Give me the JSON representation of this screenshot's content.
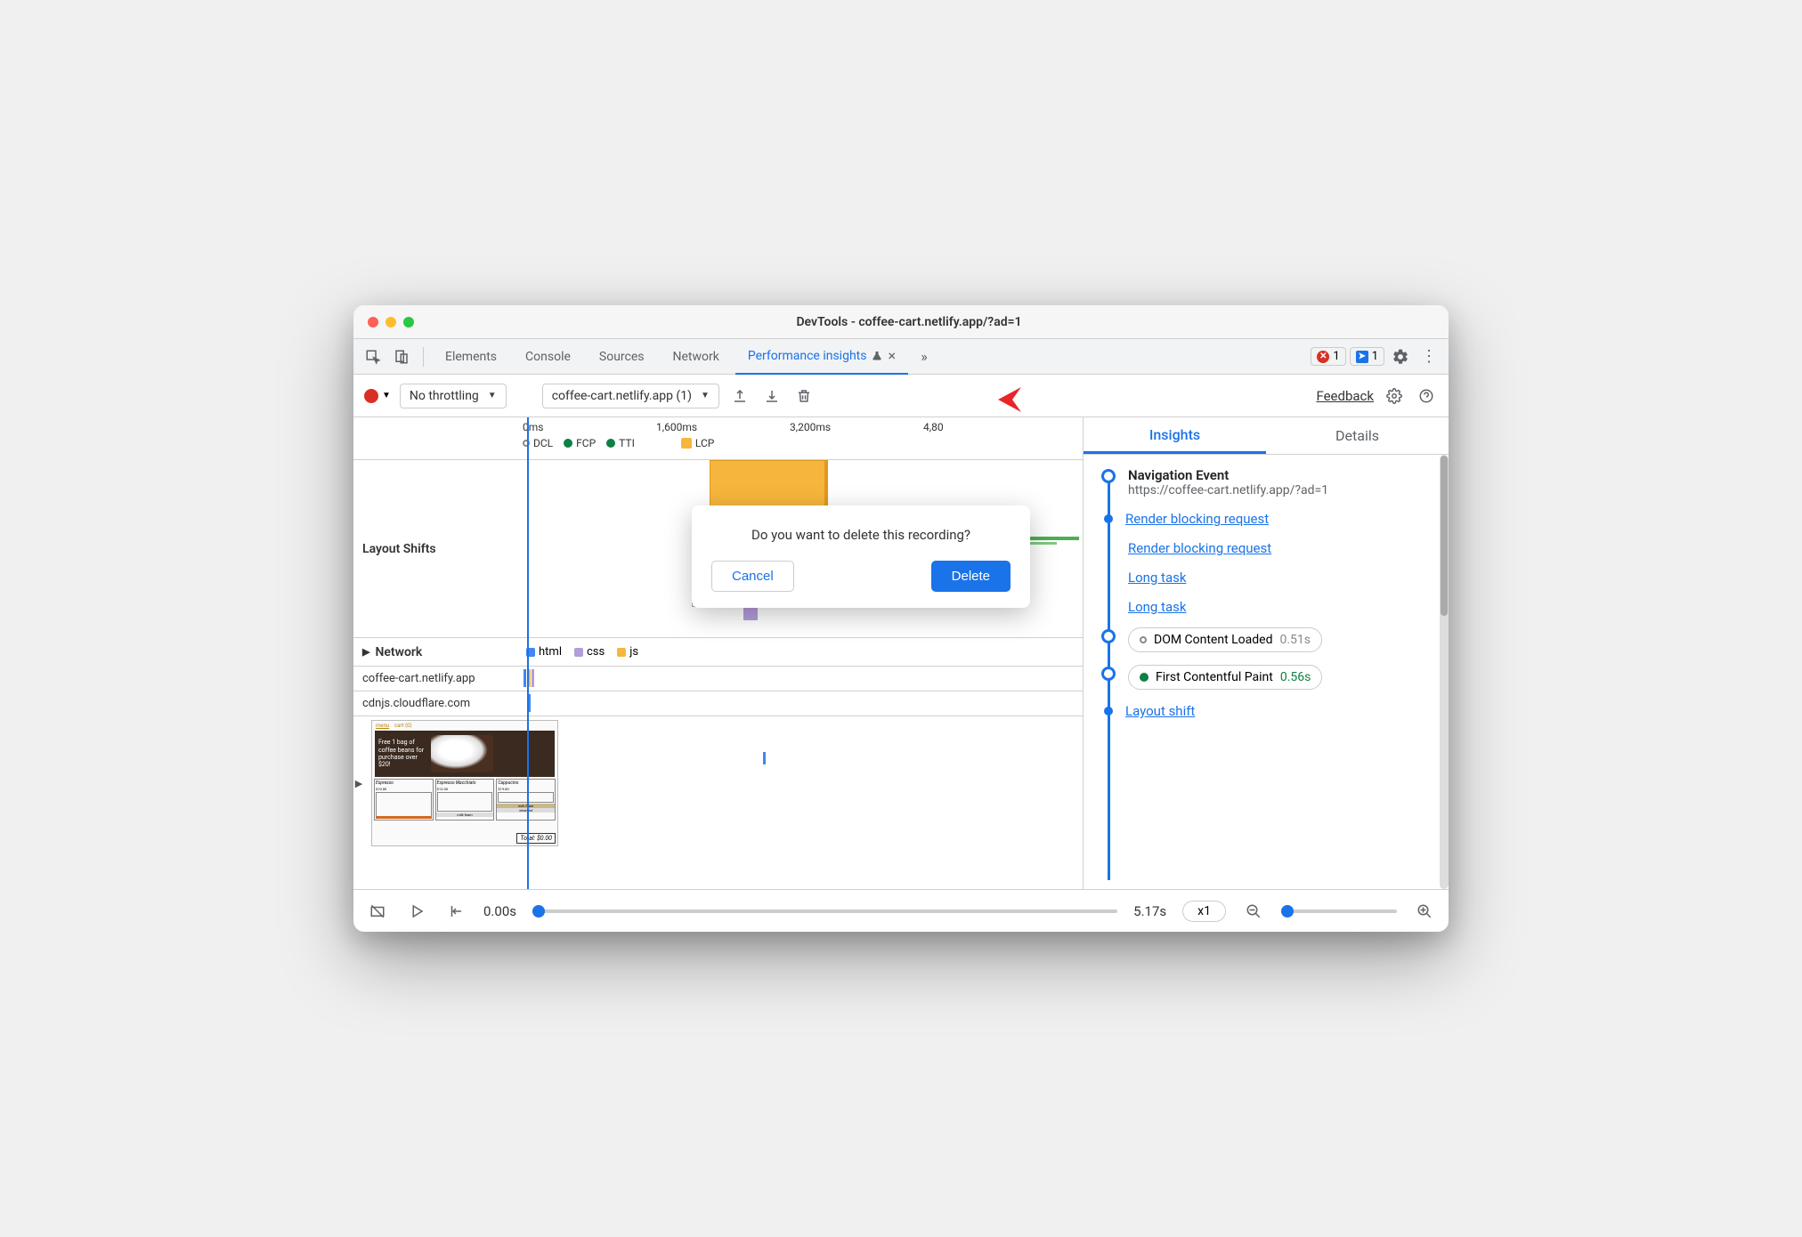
{
  "titlebar": {
    "title": "DevTools - coffee-cart.netlify.app/?ad=1"
  },
  "tabs": {
    "items": [
      "Elements",
      "Console",
      "Sources",
      "Network",
      "Performance insights"
    ],
    "activeIndex": 4,
    "errorCount": "1",
    "infoCount": "1"
  },
  "toolbar": {
    "throttling": "No throttling",
    "recording": "coffee-cart.netlify.app (1)",
    "feedback": "Feedback"
  },
  "ruler": {
    "ticks": [
      "0ms",
      "1,600ms",
      "3,200ms",
      "4,80"
    ],
    "markers": [
      {
        "type": "hollow",
        "label": "DCL"
      },
      {
        "type": "green",
        "label": "FCP"
      },
      {
        "type": "green",
        "label": "TTI"
      },
      {
        "type": "orange-sq",
        "label": "LCP"
      }
    ]
  },
  "rows": {
    "layoutShifts": "Layout Shifts",
    "network": "Network",
    "netLegend": [
      {
        "color": "#4285f4",
        "label": "html"
      },
      {
        "color": "#b39ddb",
        "label": "css"
      },
      {
        "color": "#f6b63d",
        "label": "js"
      }
    ],
    "hosts": [
      "coffee-cart.netlify.app",
      "cdnjs.cloudflare.com"
    ]
  },
  "thumbnail": {
    "promo": "Free 1 bag of coffee beans for purchase over $20!",
    "menu": "menu",
    "cart": "cart (0)",
    "products": [
      {
        "name": "Espresso",
        "price": "$10.00"
      },
      {
        "name": "Espresso Macchiato",
        "price": "$12.00"
      },
      {
        "name": "Cappucino",
        "price": "$19.00"
      }
    ],
    "milkfoam": "milk foam",
    "steamed": "steamed",
    "total": "Total: $0.00"
  },
  "dialog": {
    "message": "Do you want to delete this recording?",
    "cancel": "Cancel",
    "delete": "Delete"
  },
  "sidebar": {
    "tabs": [
      "Insights",
      "Details"
    ],
    "activeTab": 0,
    "insights": {
      "nav": {
        "title": "Navigation Event",
        "sub": "https://coffee-cart.netlify.app/?ad=1"
      },
      "links": [
        "Render blocking request",
        "Render blocking request",
        "Long task",
        "Long task"
      ],
      "dcl": {
        "label": "DOM Content Loaded",
        "val": "0.51s"
      },
      "fcp": {
        "label": "First Contentful Paint",
        "val": "0.56s"
      },
      "layoutShift": "Layout shift"
    }
  },
  "playbar": {
    "start": "0.00s",
    "end": "5.17s",
    "speed": "x1"
  }
}
